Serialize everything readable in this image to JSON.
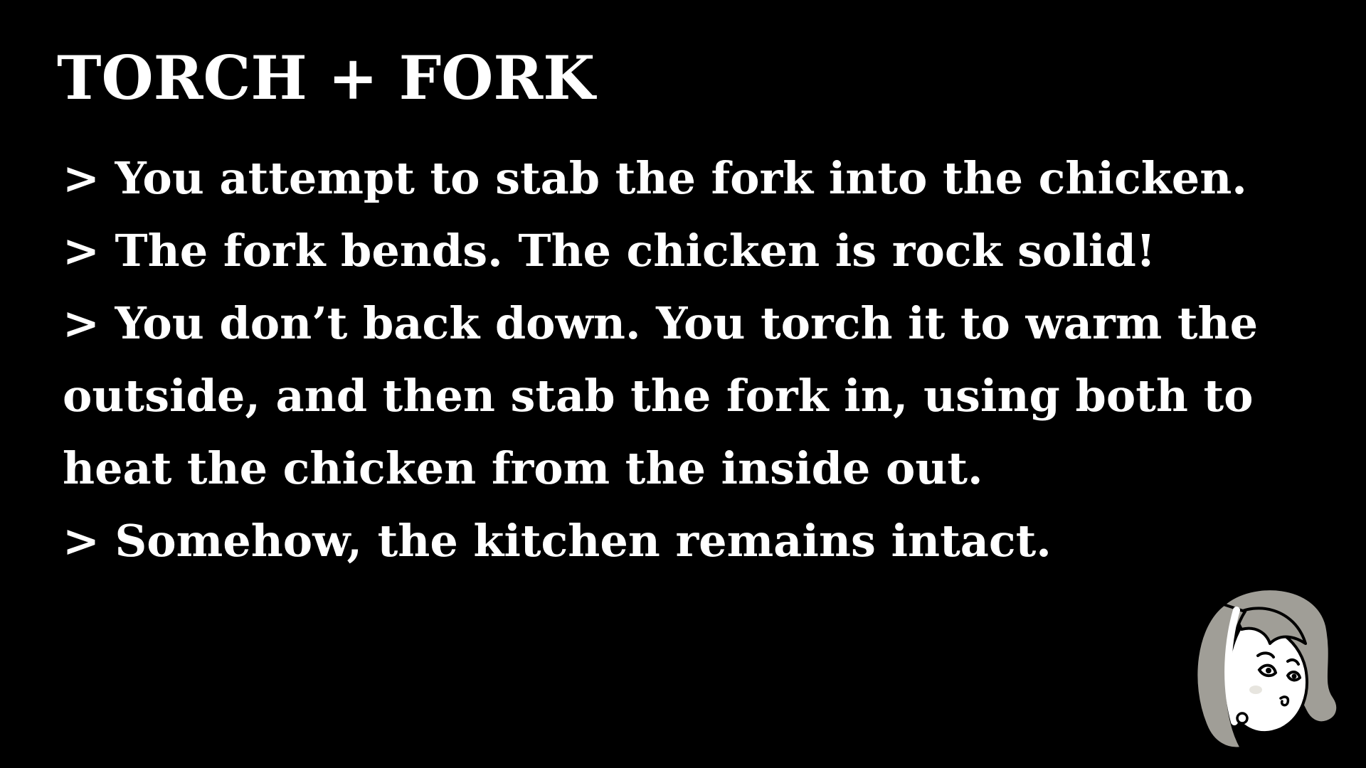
{
  "title": "TORCH + FORK",
  "log": [
    "> You attempt to stab the fork into the chicken.",
    "> The fork bends. The chicken is rock solid!",
    "> You don’t back down. You torch it to warm the outside, and then stab the fork in, using both to heat the chicken from the inside out.",
    "> Somehow, the kitchen remains intact."
  ],
  "colors": {
    "background": "#000000",
    "text": "#ffffff",
    "hair_gray": "#a09e97",
    "outline": "#000000"
  },
  "portrait": {
    "icon": "narrator-portrait-icon"
  }
}
